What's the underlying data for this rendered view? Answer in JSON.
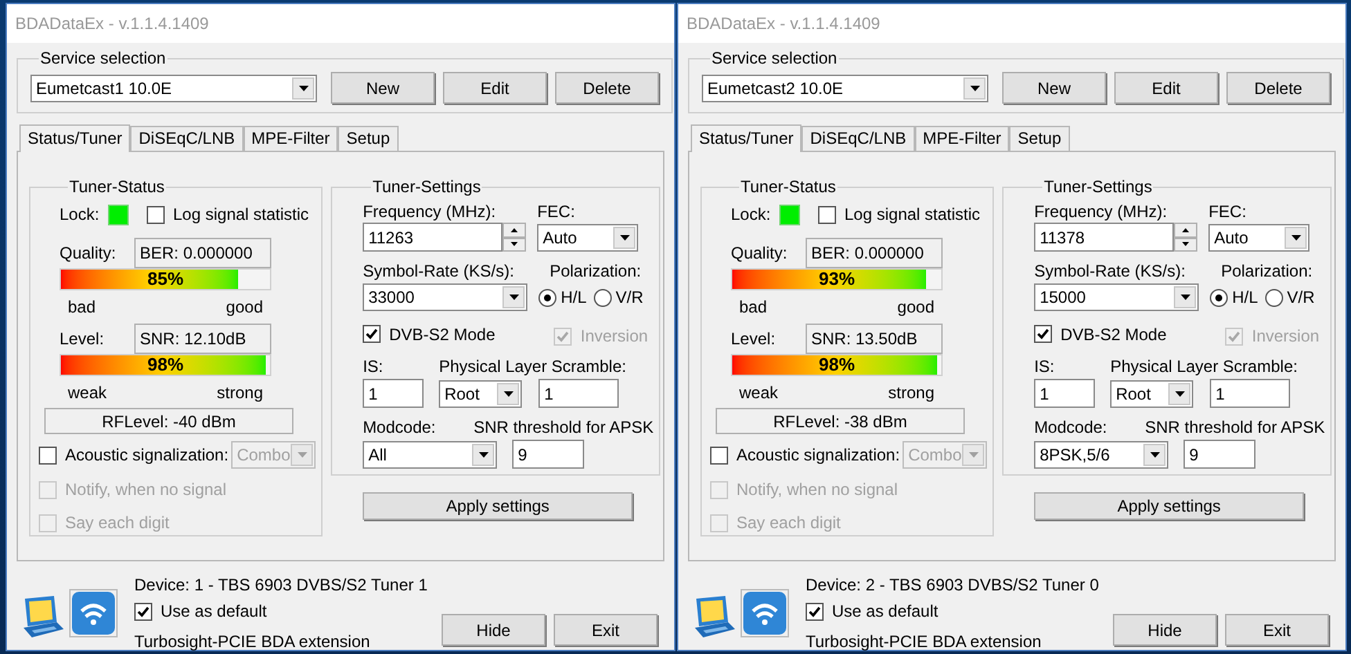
{
  "windows": [
    {
      "title": "BDADataEx - v.1.1.4.1409",
      "service_selection": {
        "label": "Service selection",
        "value": "Eumetcast1 10.0E",
        "buttons": [
          "New",
          "Edit",
          "Delete"
        ]
      },
      "tabs": [
        {
          "label": "Status/Tuner",
          "selected": true
        },
        {
          "label": "DiSEqC/LNB",
          "selected": false
        },
        {
          "label": "MPE-Filter",
          "selected": false
        },
        {
          "label": "Setup",
          "selected": false
        }
      ],
      "tuner_status": {
        "label": "Tuner-Status",
        "lock_label": "Lock:",
        "locked": true,
        "log_signal": {
          "label": "Log signal statistic",
          "checked": false
        },
        "quality": {
          "label": "Quality:",
          "reading": "BER: 0.000000",
          "level": 0.85,
          "percent": "85%",
          "low": "bad",
          "high": "good"
        },
        "signal_level": {
          "label": "Level:",
          "reading": "SNR: 12.10dB",
          "level": 0.98,
          "percent": "98%",
          "low": "weak",
          "high": "strong"
        },
        "rf_level": "RFLevel: -40 dBm",
        "acoustic": {
          "label": "Acoustic signalization:",
          "checked": false,
          "mode": "Combo",
          "mode_disabled": true
        },
        "options": [
          {
            "label": "Notify, when no signal",
            "checked": false,
            "disabled": true
          },
          {
            "label": "Say each digit",
            "checked": false,
            "disabled": true
          }
        ]
      },
      "tuner_settings": {
        "label": "Tuner-Settings",
        "frequency_label": "Frequency (MHz):",
        "frequency": "11263",
        "fec_label": "FEC:",
        "fec": "Auto",
        "symbol_rate_label": "Symbol-Rate (KS/s):",
        "symbol_rate": "33000",
        "polarization_label": "Polarization:",
        "polarizations": [
          {
            "label": "H/L",
            "selected": true
          },
          {
            "label": "V/R",
            "selected": false
          }
        ],
        "dvb_s2": {
          "label": "DVB-S2 Mode",
          "checked": true,
          "disabled": false
        },
        "inversion": {
          "label": "Inversion",
          "checked": true,
          "disabled": true
        },
        "is_label": "IS:",
        "is": "1",
        "pls_label": "Physical Layer Scramble:",
        "pls_mode": "Root",
        "pls_value": "1",
        "modcode_label": "Modcode:",
        "modcode": "All",
        "snr_threshold_label": "SNR threshold for APSK",
        "snr_threshold": "9"
      },
      "apply_button": "Apply settings",
      "device": "Device: 1 - TBS 6903 DVBS/S2 Tuner 1",
      "use_as_default": {
        "label": "Use as default",
        "checked": true
      },
      "extension": "Turbosight-PCIE BDA extension",
      "buttons": [
        "Hide",
        "Exit"
      ]
    },
    {
      "title": "BDADataEx - v.1.1.4.1409",
      "service_selection": {
        "label": "Service selection",
        "value": "Eumetcast2 10.0E",
        "buttons": [
          "New",
          "Edit",
          "Delete"
        ]
      },
      "tabs": [
        {
          "label": "Status/Tuner",
          "selected": true
        },
        {
          "label": "DiSEqC/LNB",
          "selected": false
        },
        {
          "label": "MPE-Filter",
          "selected": false
        },
        {
          "label": "Setup",
          "selected": false
        }
      ],
      "tuner_status": {
        "label": "Tuner-Status",
        "lock_label": "Lock:",
        "locked": true,
        "log_signal": {
          "label": "Log signal statistic",
          "checked": false
        },
        "quality": {
          "label": "Quality:",
          "reading": "BER: 0.000000",
          "level": 0.93,
          "percent": "93%",
          "low": "bad",
          "high": "good"
        },
        "signal_level": {
          "label": "Level:",
          "reading": "SNR: 13.50dB",
          "level": 0.98,
          "percent": "98%",
          "low": "weak",
          "high": "strong"
        },
        "rf_level": "RFLevel: -38 dBm",
        "acoustic": {
          "label": "Acoustic signalization:",
          "checked": false,
          "mode": "Combo",
          "mode_disabled": true
        },
        "options": [
          {
            "label": "Notify, when no signal",
            "checked": false,
            "disabled": true
          },
          {
            "label": "Say each digit",
            "checked": false,
            "disabled": true
          }
        ]
      },
      "tuner_settings": {
        "label": "Tuner-Settings",
        "frequency_label": "Frequency (MHz):",
        "frequency": "11378",
        "fec_label": "FEC:",
        "fec": "Auto",
        "symbol_rate_label": "Symbol-Rate (KS/s):",
        "symbol_rate": "15000",
        "polarization_label": "Polarization:",
        "polarizations": [
          {
            "label": "H/L",
            "selected": true
          },
          {
            "label": "V/R",
            "selected": false
          }
        ],
        "dvb_s2": {
          "label": "DVB-S2 Mode",
          "checked": true,
          "disabled": false
        },
        "inversion": {
          "label": "Inversion",
          "checked": true,
          "disabled": true
        },
        "is_label": "IS:",
        "is": "1",
        "pls_label": "Physical Layer Scramble:",
        "pls_mode": "Root",
        "pls_value": "1",
        "modcode_label": "Modcode:",
        "modcode": "8PSK,5/6",
        "snr_threshold_label": "SNR threshold for APSK",
        "snr_threshold": "9"
      },
      "apply_button": "Apply settings",
      "device": "Device: 2 - TBS 6903 DVBS/S2 Tuner 0",
      "use_as_default": {
        "label": "Use as default",
        "checked": true
      },
      "extension": "Turbosight-PCIE BDA extension",
      "buttons": [
        "Hide",
        "Exit"
      ]
    }
  ]
}
